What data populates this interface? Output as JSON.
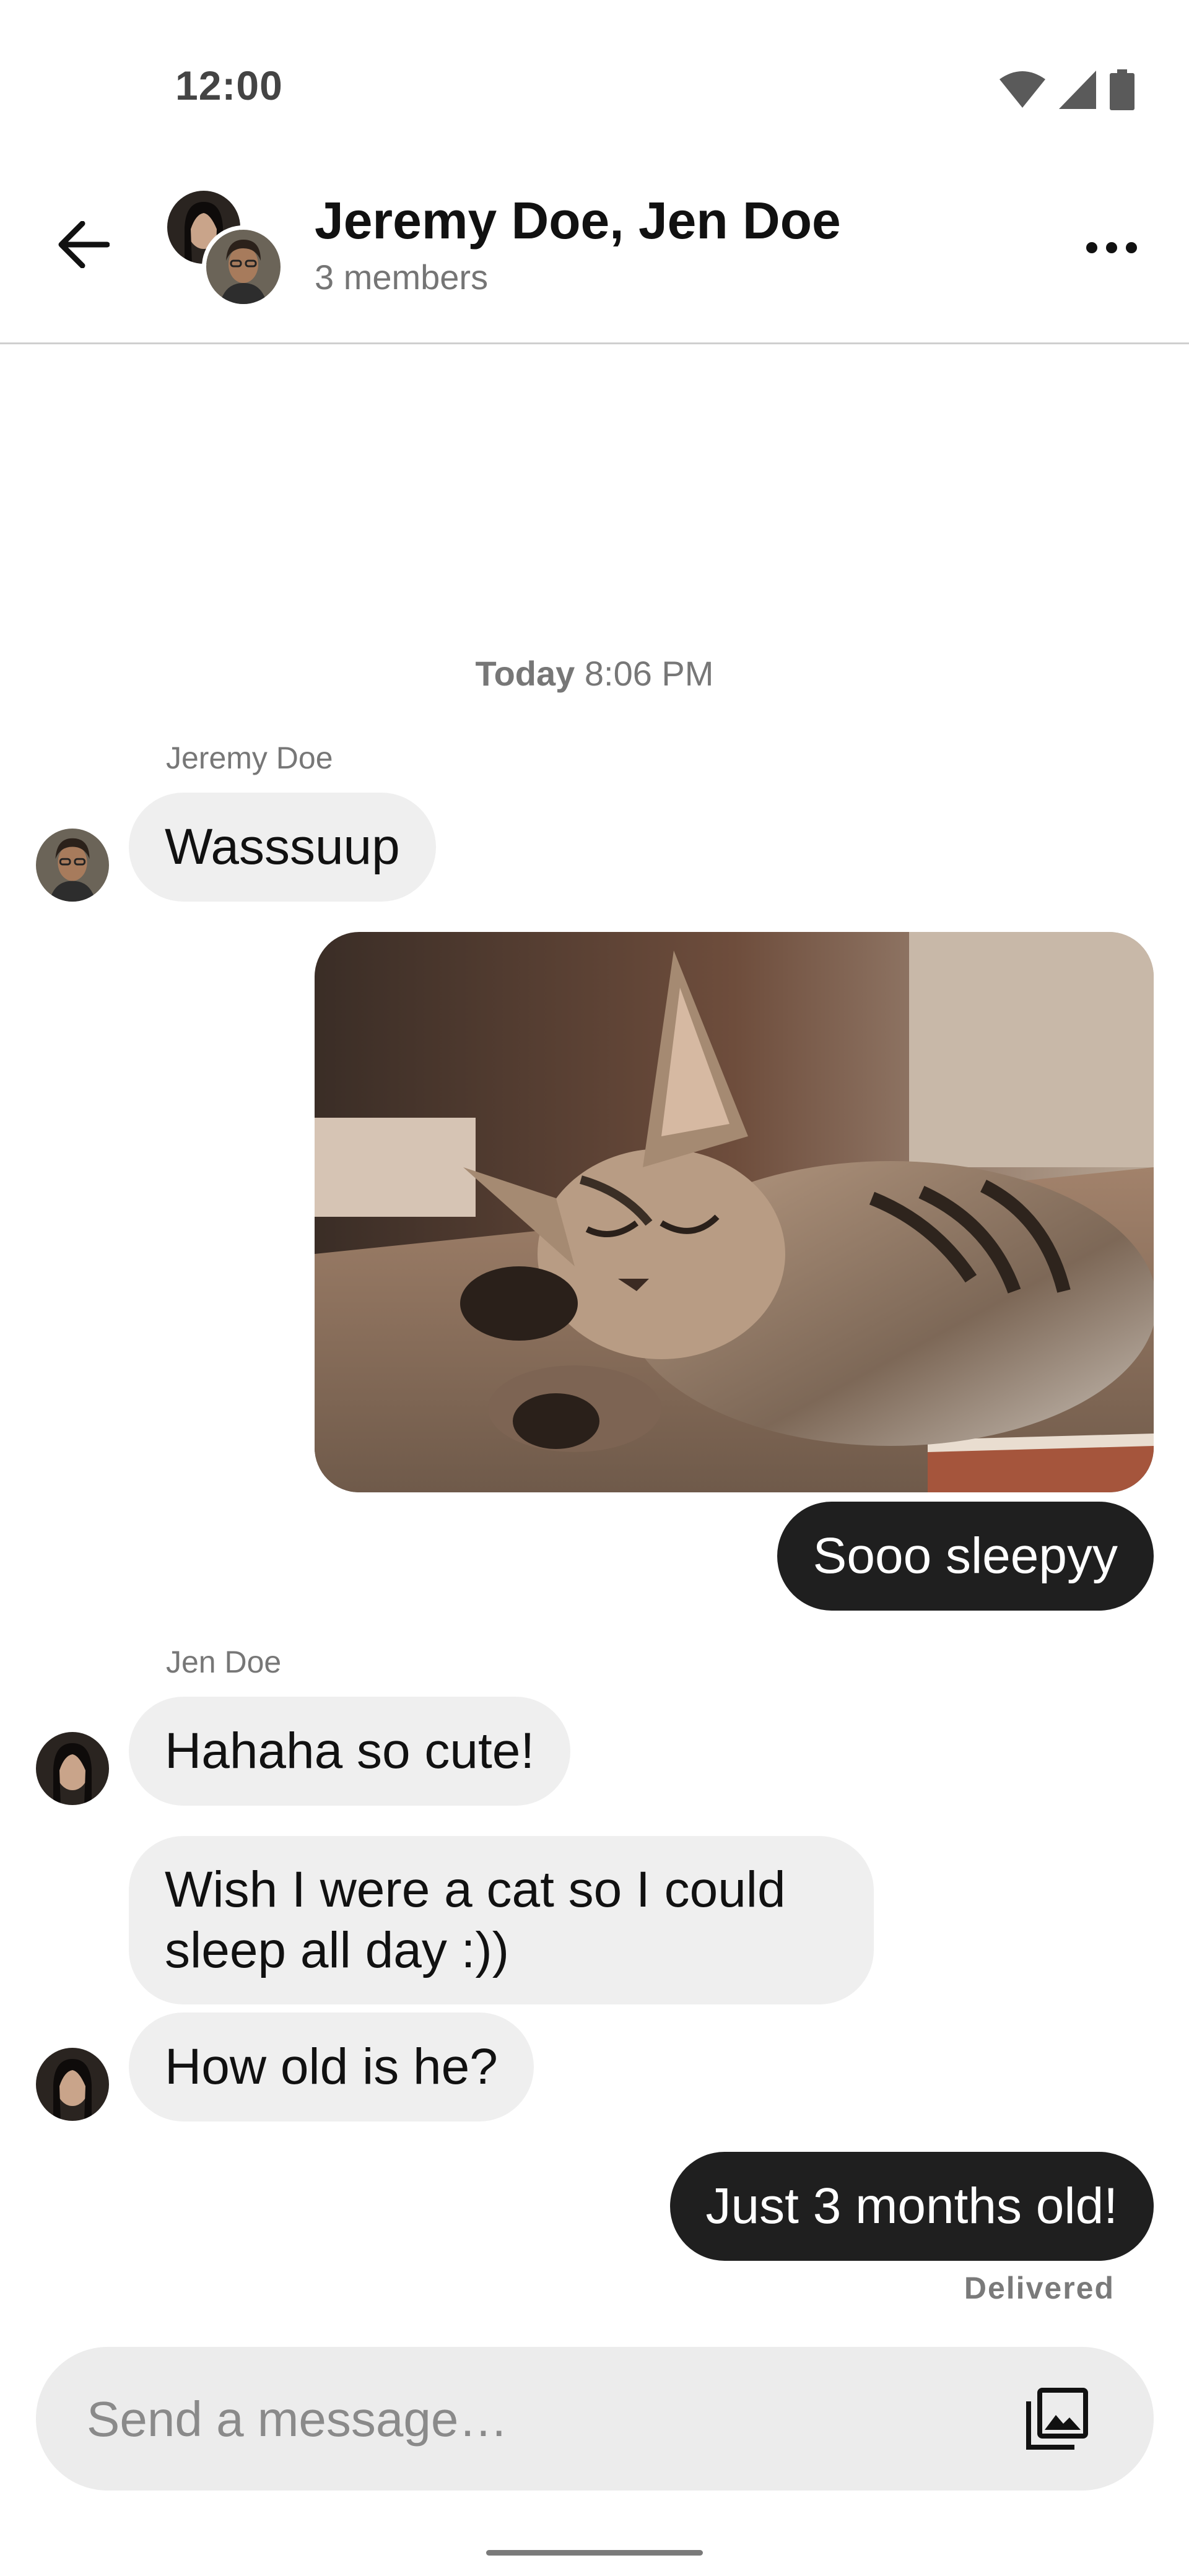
{
  "status_bar": {
    "time": "12:00",
    "icons": [
      "wifi-icon",
      "cellular-signal-icon",
      "battery-icon"
    ]
  },
  "header": {
    "title": "Jeremy Doe, Jen Doe",
    "subtitle": "3 members",
    "back_icon": "arrow-back-icon",
    "more_icon": "more-horizontal-icon"
  },
  "chat": {
    "timestamp_day": "Today",
    "timestamp_time": "8:06 PM",
    "messages": [
      {
        "sender": "Jeremy Doe",
        "text": "Wasssuup",
        "direction": "incoming"
      },
      {
        "type": "image",
        "alt": "sleeping kitten",
        "direction": "outgoing"
      },
      {
        "text": "Sooo sleepyy",
        "direction": "outgoing"
      },
      {
        "sender": "Jen Doe",
        "text": "Hahaha so cute!",
        "direction": "incoming"
      },
      {
        "text": "Wish I were a cat so I could sleep all day :))",
        "direction": "incoming"
      },
      {
        "text": "How old is he?",
        "direction": "incoming"
      },
      {
        "text": "Just 3 months old!",
        "direction": "outgoing",
        "status": "Delivered"
      }
    ]
  },
  "composer": {
    "placeholder": "Send a message…",
    "gallery_icon": "photo-library-icon"
  },
  "colors": {
    "incoming_bubble": "#efefef",
    "outgoing_bubble": "#1f1f1f",
    "background": "#ffffff"
  }
}
